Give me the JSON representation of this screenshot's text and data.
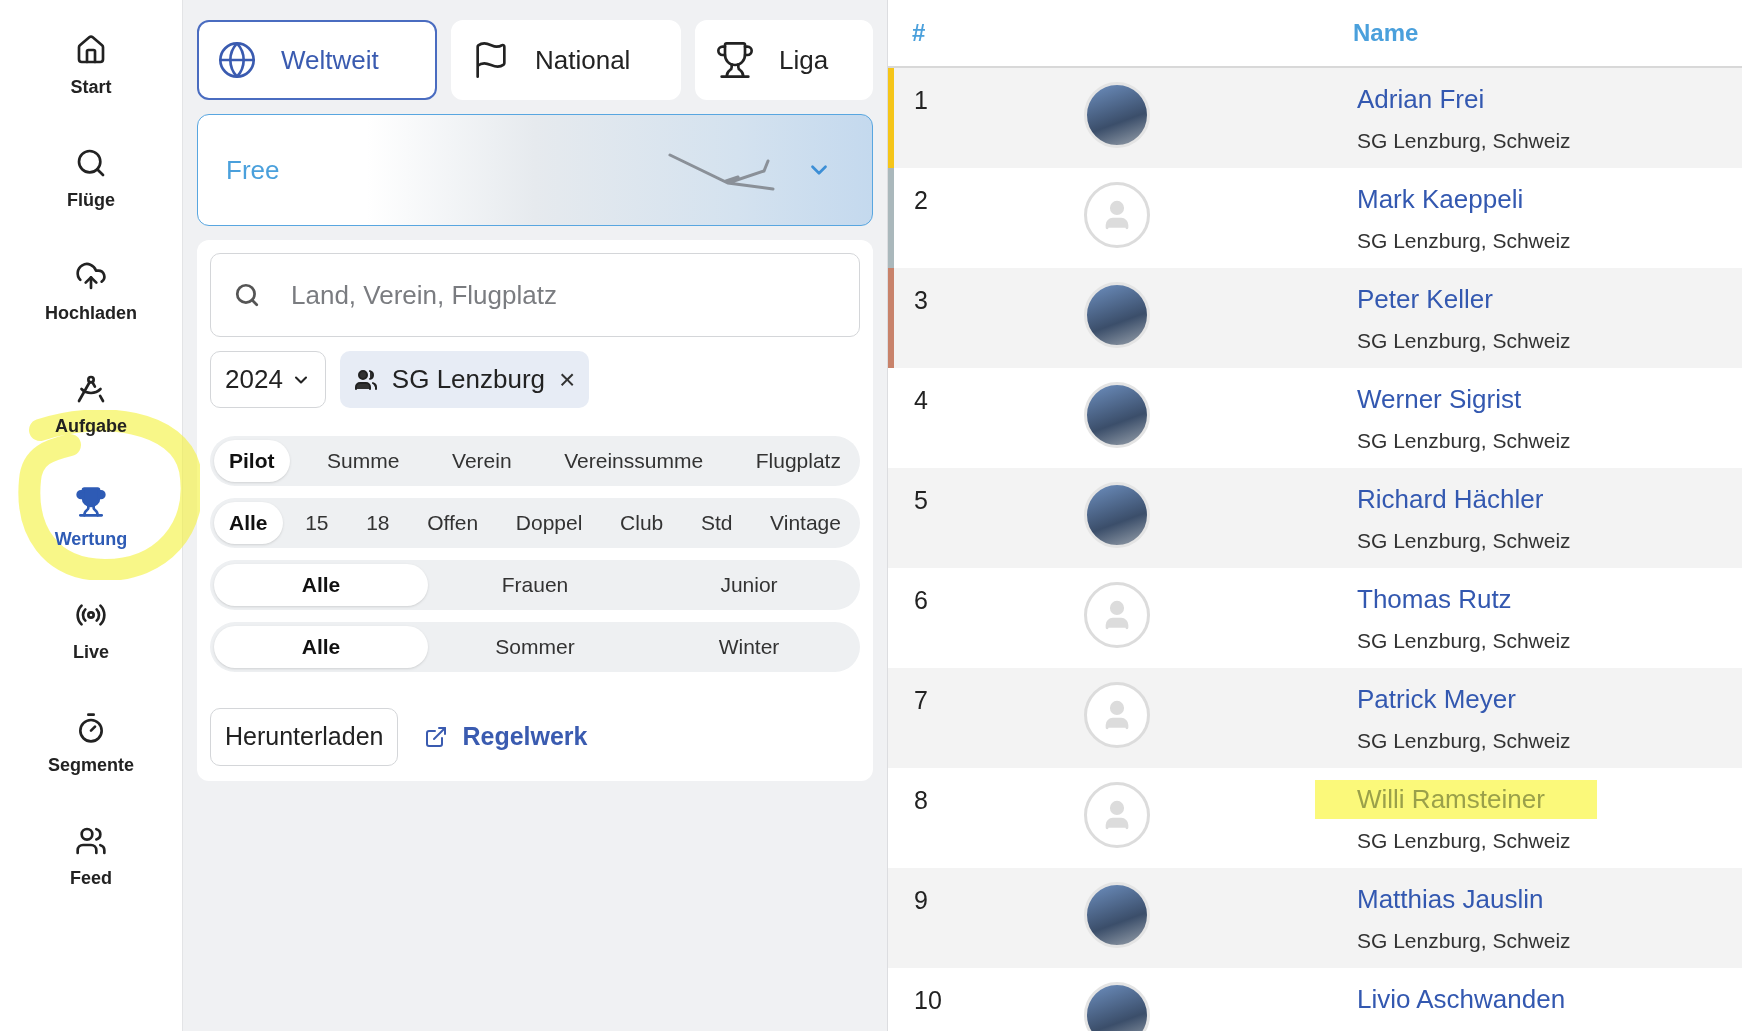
{
  "sidebar": {
    "items": [
      {
        "label": "Start",
        "selected": false
      },
      {
        "label": "Flüge",
        "selected": false
      },
      {
        "label": "Hochladen",
        "selected": false
      },
      {
        "label": "Aufgabe",
        "selected": false
      },
      {
        "label": "Wertung",
        "selected": true
      },
      {
        "label": "Live",
        "selected": false
      },
      {
        "label": "Segmente",
        "selected": false
      },
      {
        "label": "Feed",
        "selected": false
      }
    ]
  },
  "scope_tabs": [
    {
      "label": "Weltweit",
      "selected": true
    },
    {
      "label": "National",
      "selected": false
    },
    {
      "label": "Liga",
      "selected": false
    }
  ],
  "category": {
    "value": "Free"
  },
  "search": {
    "placeholder": "Land, Verein, Flugplatz"
  },
  "year": {
    "value": "2024"
  },
  "club_chip": {
    "label": "SG Lenzburg",
    "close": "×"
  },
  "segments": [
    [
      {
        "label": "Pilot",
        "selected": true
      },
      {
        "label": "Summe",
        "selected": false
      },
      {
        "label": "Verein",
        "selected": false
      },
      {
        "label": "Vereinssumme",
        "selected": false
      },
      {
        "label": "Flugplatz",
        "selected": false
      }
    ],
    [
      {
        "label": "Alle",
        "selected": true
      },
      {
        "label": "15",
        "selected": false
      },
      {
        "label": "18",
        "selected": false
      },
      {
        "label": "Offen",
        "selected": false
      },
      {
        "label": "Doppel",
        "selected": false
      },
      {
        "label": "Club",
        "selected": false
      },
      {
        "label": "Std",
        "selected": false
      },
      {
        "label": "Vintage",
        "selected": false
      }
    ],
    [
      {
        "label": "Alle",
        "selected": true
      },
      {
        "label": "Frauen",
        "selected": false
      },
      {
        "label": "Junior",
        "selected": false
      }
    ],
    [
      {
        "label": "Alle",
        "selected": true
      },
      {
        "label": "Sommer",
        "selected": false
      },
      {
        "label": "Winter",
        "selected": false
      }
    ]
  ],
  "download_button": "Herunterladen",
  "rules_link": "Regelwerk",
  "table": {
    "columns": [
      "#",
      "Name"
    ],
    "rows": [
      {
        "rank": "1",
        "kind": "photo",
        "name": "Adrian Frei",
        "club": "SG Lenzburg, Schweiz",
        "color": "#f5c518",
        "highlighted": false
      },
      {
        "rank": "2",
        "kind": "placeholder",
        "name": "Mark Kaeppeli",
        "club": "SG Lenzburg, Schweiz",
        "color": "#aab8bc",
        "highlighted": false
      },
      {
        "rank": "3",
        "kind": "photo",
        "name": "Peter Keller",
        "club": "SG Lenzburg, Schweiz",
        "color": "#c8826a",
        "highlighted": false
      },
      {
        "rank": "4",
        "kind": "photo",
        "name": "Werner Sigrist",
        "club": "SG Lenzburg, Schweiz",
        "highlighted": false
      },
      {
        "rank": "5",
        "kind": "photo",
        "name": "Richard Hächler",
        "club": "SG Lenzburg, Schweiz",
        "highlighted": false
      },
      {
        "rank": "6",
        "kind": "placeholder",
        "name": "Thomas Rutz",
        "club": "SG Lenzburg, Schweiz",
        "highlighted": false
      },
      {
        "rank": "7",
        "kind": "placeholder",
        "name": "Patrick Meyer",
        "club": "SG Lenzburg, Schweiz",
        "highlighted": false
      },
      {
        "rank": "8",
        "kind": "placeholder",
        "name": "Willi Ramsteiner",
        "club": "SG Lenzburg, Schweiz",
        "highlighted": true
      },
      {
        "rank": "9",
        "kind": "photo",
        "name": "Matthias Jauslin",
        "club": "SG Lenzburg, Schweiz",
        "highlighted": false
      },
      {
        "rank": "10",
        "kind": "photo",
        "name": "Livio Aschwanden",
        "highlighted": false
      }
    ]
  }
}
